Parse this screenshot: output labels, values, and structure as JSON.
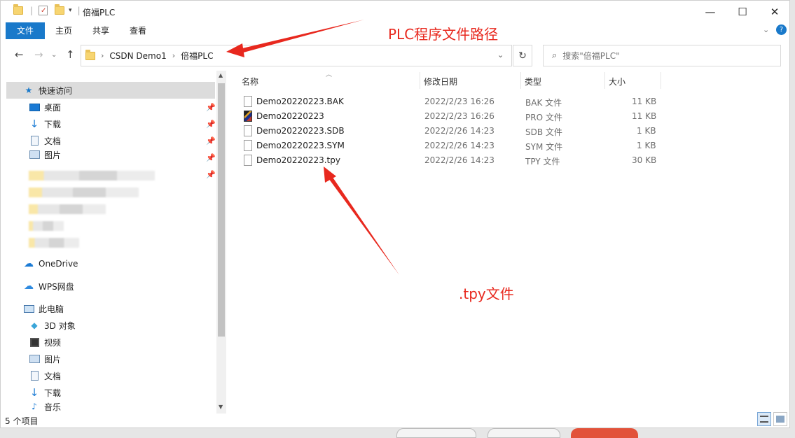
{
  "title": "倍福PLC",
  "ribbon": {
    "tabs": [
      "文件",
      "主页",
      "共享",
      "查看"
    ]
  },
  "window_controls": {
    "minimize": "—",
    "maximize": "☐",
    "close": "✕"
  },
  "address": {
    "crumbs": [
      "CSDN Demo1",
      "倍福PLC"
    ]
  },
  "search": {
    "placeholder": "搜索\"倍福PLC\""
  },
  "sidebar": {
    "quick_access": "快速访问",
    "pinned": [
      "桌面",
      "下载",
      "文档",
      "图片"
    ],
    "locations": [
      "OneDrive",
      "WPS网盘",
      "此电脑"
    ],
    "this_pc": [
      "3D 对象",
      "视频",
      "图片",
      "文档",
      "下载",
      "音乐"
    ]
  },
  "columns": [
    "名称",
    "修改日期",
    "类型",
    "大小"
  ],
  "files": [
    {
      "name": "Demo20220223.BAK",
      "date": "2022/2/23 16:26",
      "type": "BAK 文件",
      "size": "11 KB",
      "icon": "doc-icon"
    },
    {
      "name": "Demo20220223",
      "date": "2022/2/23 16:26",
      "type": "PRO 文件",
      "size": "11 KB",
      "icon": "pro-icon"
    },
    {
      "name": "Demo20220223.SDB",
      "date": "2022/2/26 14:23",
      "type": "SDB 文件",
      "size": "1 KB",
      "icon": "doc-icon"
    },
    {
      "name": "Demo20220223.SYM",
      "date": "2022/2/26 14:23",
      "type": "SYM 文件",
      "size": "1 KB",
      "icon": "doc-icon"
    },
    {
      "name": "Demo20220223.tpy",
      "date": "2022/2/26 14:23",
      "type": "TPY 文件",
      "size": "30 KB",
      "icon": "doc-icon"
    }
  ],
  "status": {
    "count": "5 个项目"
  },
  "annotations": {
    "path_note": "PLC程序文件路径",
    "tpy_note": ".tpy文件",
    "color": "#e8281e"
  }
}
